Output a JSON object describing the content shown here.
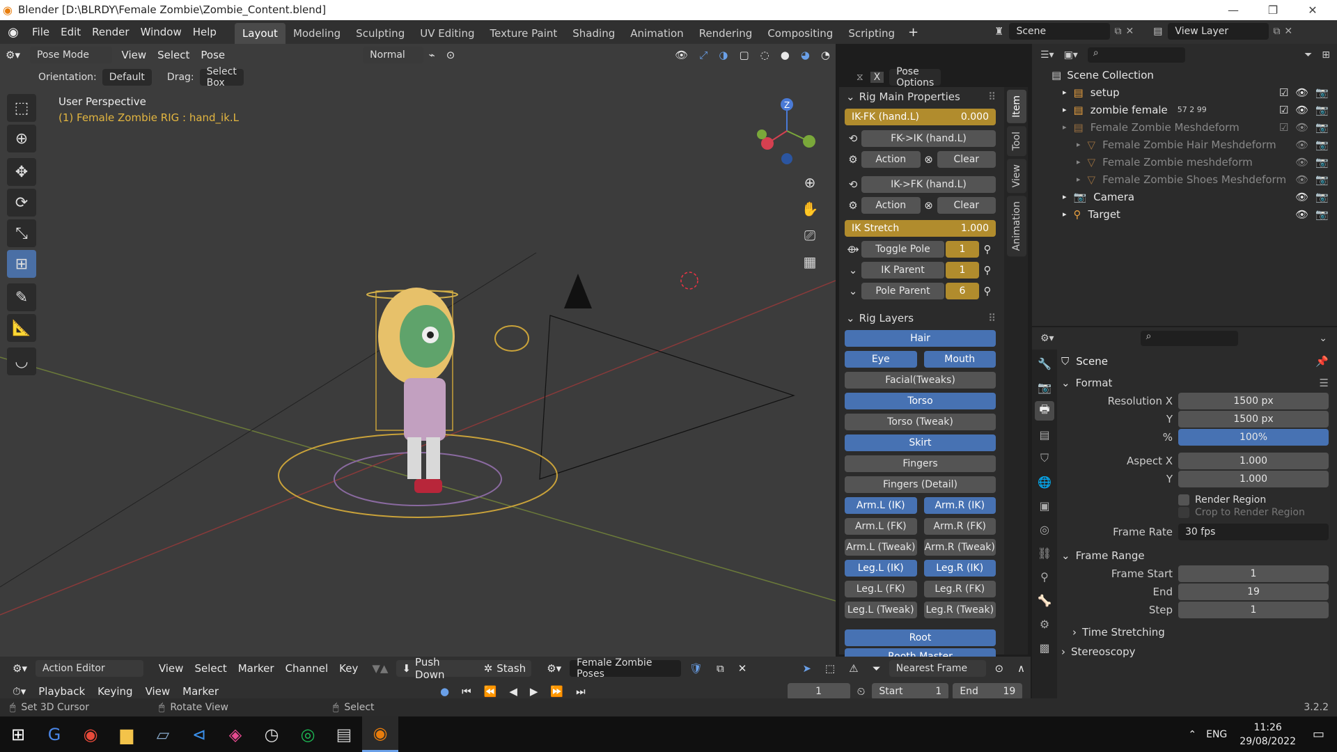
{
  "window": {
    "title": "Blender [D:\\BLRDY\\Female Zombie\\Zombie_Content.blend]"
  },
  "menus": [
    "File",
    "Edit",
    "Render",
    "Window",
    "Help"
  ],
  "workspaces": [
    "Layout",
    "Modeling",
    "Sculpting",
    "UV Editing",
    "Texture Paint",
    "Shading",
    "Animation",
    "Rendering",
    "Compositing",
    "Scripting"
  ],
  "active_workspace": "Layout",
  "scene": {
    "name": "Scene",
    "view_layer": "View Layer"
  },
  "viewport_header": {
    "mode": "Pose Mode",
    "menus": [
      "View",
      "Select",
      "Pose"
    ],
    "pivot": "Normal"
  },
  "options_bar": {
    "orientation_label": "Orientation:",
    "orientation": "Default",
    "drag_label": "Drag:",
    "drag": "Select Box",
    "pose_options": "Pose Options"
  },
  "viewport": {
    "title": "User Perspective",
    "subtitle": "(1) Female Zombie RIG : hand_ik.L"
  },
  "npanel": {
    "tabs": [
      "Item",
      "Tool",
      "View",
      "Animation"
    ],
    "rig_main_title": "Rig Main Properties",
    "ik_fk": {
      "label": "IK-FK (hand.L)",
      "value": "0.000"
    },
    "fk_to_ik": "FK->IK (hand.L)",
    "ik_to_fk": "IK->FK (hand.L)",
    "action": "Action",
    "clear": "Clear",
    "ik_stretch": {
      "label": "IK Stretch",
      "value": "1.000"
    },
    "toggle_pole": {
      "label": "Toggle Pole",
      "value": "1"
    },
    "ik_parent": {
      "label": "IK Parent",
      "value": "1"
    },
    "pole_parent": {
      "label": "Pole Parent",
      "value": "6"
    },
    "rig_layers_title": "Rig Layers",
    "layers": [
      [
        {
          "label": "Hair",
          "on": true
        }
      ],
      [
        {
          "label": "Eye",
          "on": true
        },
        {
          "label": "Mouth",
          "on": true
        }
      ],
      [
        {
          "label": "Facial(Tweaks)",
          "on": false
        }
      ],
      [
        {
          "label": "Torso",
          "on": true
        }
      ],
      [
        {
          "label": "Torso (Tweak)",
          "on": false
        }
      ],
      [
        {
          "label": "Skirt",
          "on": true
        }
      ],
      [
        {
          "label": "Fingers",
          "on": false
        }
      ],
      [
        {
          "label": "Fingers (Detail)",
          "on": false
        }
      ],
      [
        {
          "label": "Arm.L (IK)",
          "on": true
        },
        {
          "label": "Arm.R (IK)",
          "on": true
        }
      ],
      [
        {
          "label": "Arm.L (FK)",
          "on": false
        },
        {
          "label": "Arm.R (FK)",
          "on": false
        }
      ],
      [
        {
          "label": "Arm.L (Tweak)",
          "on": false
        },
        {
          "label": "Arm.R (Tweak)",
          "on": false
        }
      ],
      [
        {
          "label": "Leg.L (IK)",
          "on": true
        },
        {
          "label": "Leg.R (IK)",
          "on": true
        }
      ],
      [
        {
          "label": "Leg.L (FK)",
          "on": false
        },
        {
          "label": "Leg.R (FK)",
          "on": false
        }
      ],
      [
        {
          "label": "Leg.L (Tweak)",
          "on": false
        },
        {
          "label": "Leg.R (Tweak)",
          "on": false
        }
      ]
    ],
    "root": "Root",
    "root_master": "Rooth Master"
  },
  "outliner": {
    "root": "Scene Collection",
    "items": [
      {
        "label": "setup",
        "dim": false
      },
      {
        "label": "zombie female",
        "dim": false,
        "badge": "57 2 99"
      },
      {
        "label": "Female Zombie Meshdeform",
        "dim": true
      },
      {
        "label": "Female Zombie Hair Meshdeform",
        "dim": true
      },
      {
        "label": "Female Zombie meshdeform",
        "dim": true
      },
      {
        "label": "Female Zombie Shoes Meshdeform",
        "dim": true
      },
      {
        "label": "Camera",
        "dim": false
      },
      {
        "label": "Target",
        "dim": false
      }
    ]
  },
  "properties": {
    "context": "Scene",
    "format_title": "Format",
    "res_x_label": "Resolution X",
    "res_x": "1500 px",
    "res_y_label": "Y",
    "res_y": "1500 px",
    "pct_label": "%",
    "pct": "100%",
    "aspect_x_label": "Aspect X",
    "aspect_x": "1.000",
    "aspect_y_label": "Y",
    "aspect_y": "1.000",
    "render_region": "Render Region",
    "crop": "Crop to Render Region",
    "frame_rate_label": "Frame Rate",
    "frame_rate": "30 fps",
    "frame_range_title": "Frame Range",
    "frame_start_label": "Frame Start",
    "frame_start": "1",
    "end_label": "End",
    "end": "19",
    "step_label": "Step",
    "step": "1",
    "time_stretching": "Time Stretching",
    "stereoscopy": "Stereoscopy"
  },
  "action_editor": {
    "type": "Action Editor",
    "menus": [
      "View",
      "Select",
      "Marker",
      "Channel",
      "Key"
    ],
    "push_down": "Push Down",
    "stash": "Stash",
    "action_name": "Female Zombie Poses",
    "snap": "Nearest Frame"
  },
  "timeline": {
    "playback": "Playback",
    "keying": "Keying",
    "view": "View",
    "marker": "Marker",
    "current_frame": "1",
    "start_label": "Start",
    "start": "1",
    "end_label": "End",
    "end": "19"
  },
  "status": {
    "left": "Set 3D Cursor",
    "mid": "Rotate View",
    "right": "Select",
    "version": "3.2.2"
  },
  "taskbar": {
    "lang": "ENG",
    "time": "11:26",
    "date": "29/08/2022"
  }
}
